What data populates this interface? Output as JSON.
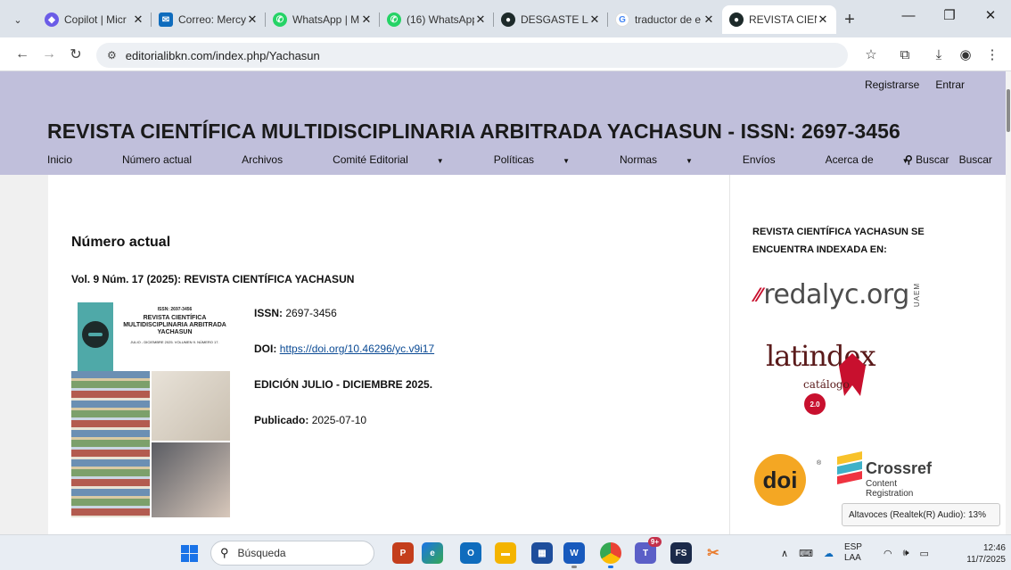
{
  "browser": {
    "tabs": [
      {
        "title": "Copilot | Micr",
        "icon_color": "#6b5ce7",
        "glyph": "◆"
      },
      {
        "title": "Correo: Mercy",
        "icon_color": "#0f6cbd",
        "glyph": "✉"
      },
      {
        "title": "WhatsApp | M",
        "icon_color": "#25d366",
        "glyph": "✆"
      },
      {
        "title": "(16) WhatsApp",
        "icon_color": "#25d366",
        "glyph": "✆"
      },
      {
        "title": "DESGASTE LA",
        "icon_color": "#1d2a2a",
        "glyph": "●"
      },
      {
        "title": "traductor de e",
        "icon_color": "#4285f4",
        "glyph": "G"
      },
      {
        "title": "REVISTA CIEN",
        "icon_color": "#1d2a2a",
        "glyph": "●"
      }
    ],
    "tab_close_glyph": "✕",
    "new_tab_glyph": "+",
    "url": "editorialibkn.com/index.php/Yachasun"
  },
  "site": {
    "user_links": {
      "register": "Registrarse",
      "login": "Entrar"
    },
    "title": "REVISTA CIENTÍFICA MULTIDISCIPLINARIA ARBITRADA YACHASUN - ISSN: 2697-3456",
    "nav": [
      {
        "label": "Inicio",
        "dropdown": false
      },
      {
        "label": "Número actual",
        "dropdown": false
      },
      {
        "label": "Archivos",
        "dropdown": false
      },
      {
        "label": "Comité Editorial",
        "dropdown": true
      },
      {
        "label": "Políticas",
        "dropdown": true
      },
      {
        "label": "Normas",
        "dropdown": true
      },
      {
        "label": "Envíos",
        "dropdown": false
      },
      {
        "label": "Acerca de",
        "dropdown": true
      },
      {
        "label": "Buscar",
        "dropdown": false
      }
    ],
    "search_label": "Buscar"
  },
  "main": {
    "heading": "Número actual",
    "issue_title": "Vol. 9 Núm. 17 (2025): REVISTA CIENTÍFICA YACHASUN",
    "cover": {
      "issn": "ISSN: 2697-3456",
      "name": "REVISTA CIENTÍFICA MULTIDISCIPLINARIA ARBITRADA YACHASUN",
      "edition": "JULIO - DICIEMBRE 2025. VOLUMEN 9. NÚMERO 17."
    },
    "issn_label": "ISSN:",
    "issn_value": "2697-3456",
    "doi_label": "DOI:",
    "doi_value": "https://doi.org/10.46296/yc.v9i17",
    "edition": "EDICIÓN JULIO - DICIEMBRE 2025.",
    "published_label": "Publicado:",
    "published_value": "2025-07-10"
  },
  "sidebar": {
    "heading": "REVISTA CIENTÍFICA YACHASUN SE ENCUENTRA INDEXADA EN:",
    "redalyc": "redalyc.org",
    "redalyc_sub": "UAEM",
    "latindex": "latindex",
    "latindex_sub": "catálogo",
    "latindex_version": "2.0",
    "doi": "doi",
    "crossref": "Crossref",
    "crossref_sub": "Content Registration"
  },
  "tooltip": "Altavoces (Realtek(R) Audio): 13%",
  "taskbar": {
    "search_placeholder": "Búsqueda",
    "lang_top": "ESP",
    "lang_bottom": "LAA",
    "time": "12:46",
    "date": "11/7/2025",
    "teams_badge": "9+"
  }
}
